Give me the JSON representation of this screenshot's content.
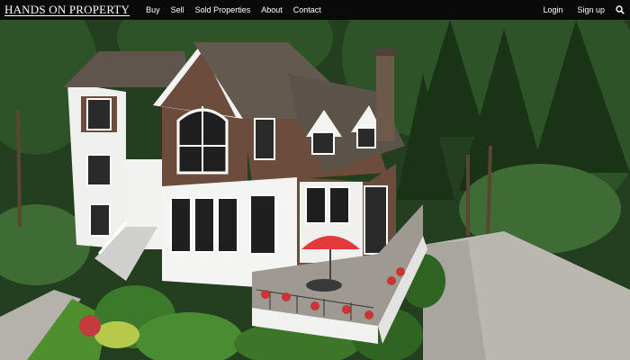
{
  "brand": {
    "logo_text": "HANDS ON PROPERTY"
  },
  "nav": {
    "items": [
      {
        "label": "Buy"
      },
      {
        "label": "Sell"
      },
      {
        "label": "Sold Properties"
      },
      {
        "label": "About"
      },
      {
        "label": "Contact"
      }
    ]
  },
  "account": {
    "login_label": "Login",
    "signup_label": "Sign up"
  },
  "icons": {
    "search": "search-icon"
  },
  "colors": {
    "topbar": "#0a0a0a",
    "umbrella": "#e23a3a",
    "trim": "#f3f3f1",
    "shingle": "#6b4c3d"
  }
}
